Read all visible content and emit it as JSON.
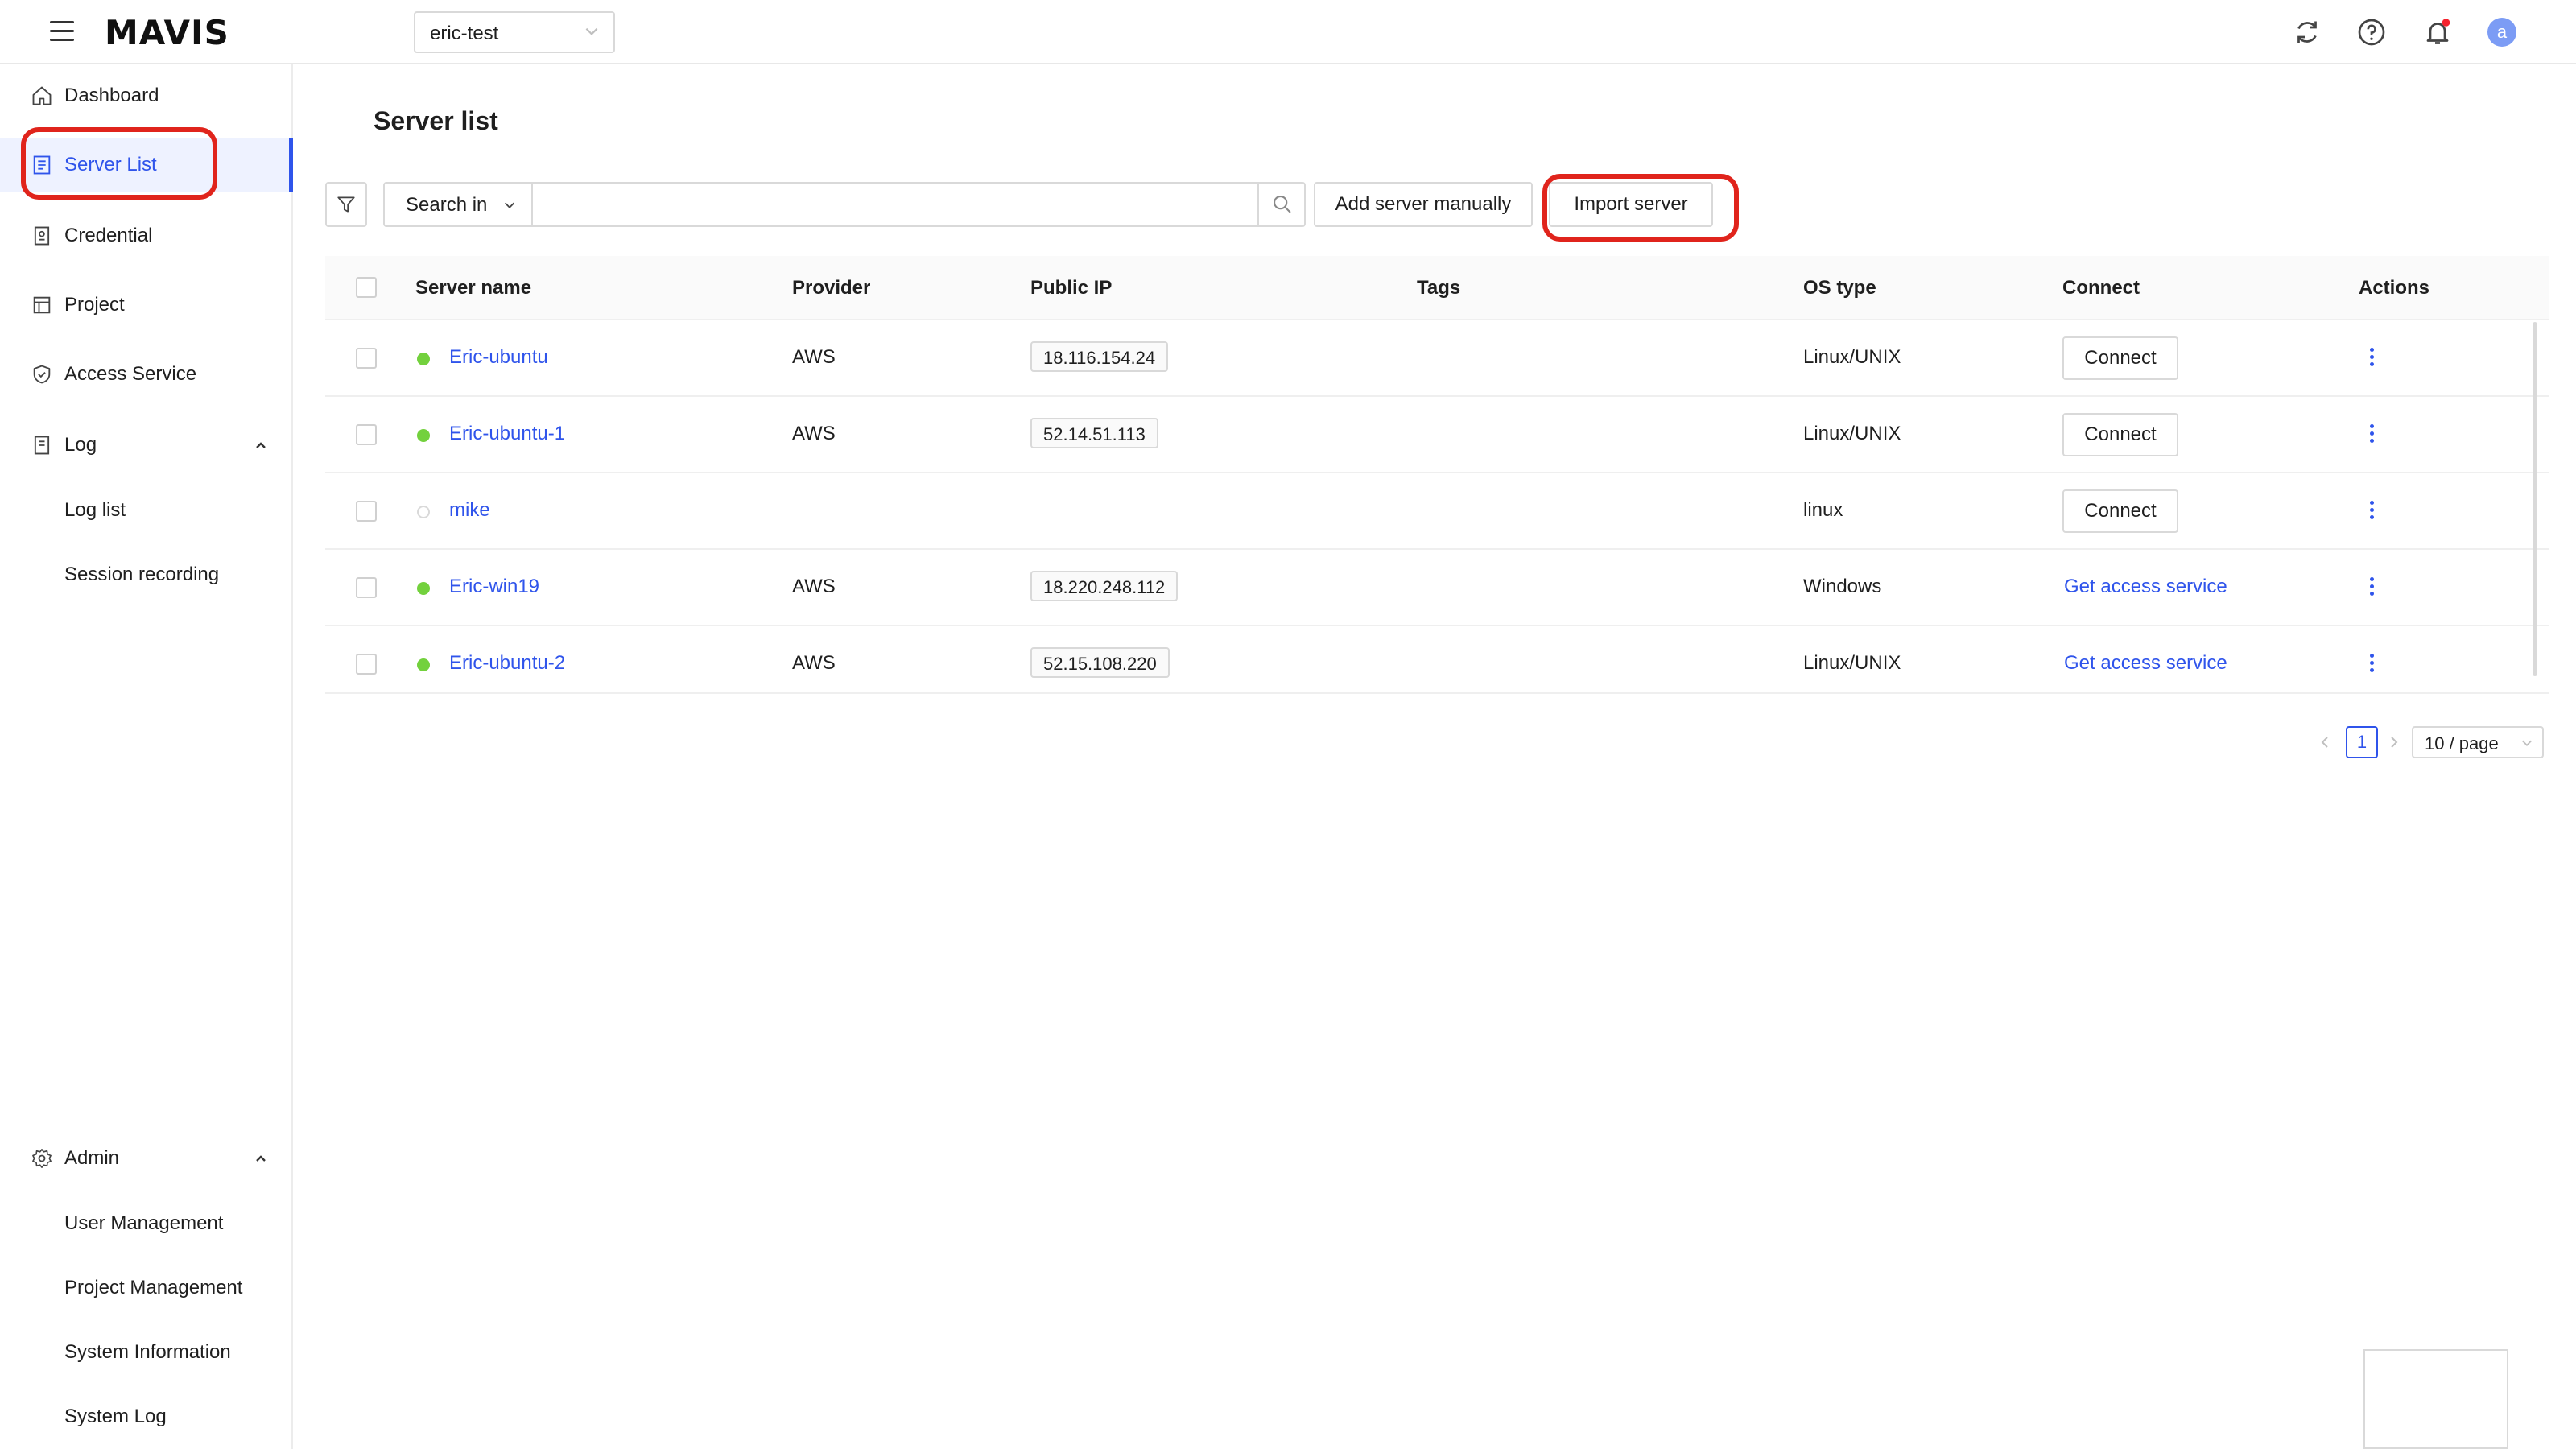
{
  "app": {
    "logo": "MAVIS",
    "project_selector": "eric-test"
  },
  "sidebar": {
    "items": [
      {
        "label": "Dashboard",
        "icon": "home-icon"
      },
      {
        "label": "Server List",
        "icon": "server-list-icon",
        "active": true
      },
      {
        "label": "Credential",
        "icon": "credential-icon"
      },
      {
        "label": "Project",
        "icon": "project-icon"
      },
      {
        "label": "Access Service",
        "icon": "shield-icon"
      },
      {
        "label": "Log",
        "icon": "log-icon",
        "expanded": true
      }
    ],
    "log_children": [
      "Log list",
      "Session recording"
    ],
    "admin": {
      "label": "Admin",
      "icon": "gear-icon",
      "expanded": true
    },
    "admin_children": [
      "User Management",
      "Project Management",
      "System Information",
      "System Log"
    ]
  },
  "main": {
    "title": "Server list",
    "search_in_label": "Search in",
    "search_placeholder": "",
    "add_server_label": "Add server manually",
    "import_server_label": "Import server"
  },
  "table": {
    "columns": [
      "Server name",
      "Provider",
      "Public IP",
      "Tags",
      "OS type",
      "Connect",
      "Actions"
    ],
    "rows": [
      {
        "name": "Eric-ubuntu",
        "status": "online",
        "provider": "AWS",
        "ip": "18.116.154.24",
        "tags": "",
        "os": "Linux/UNIX",
        "connect": "Connect",
        "connect_type": "button"
      },
      {
        "name": "Eric-ubuntu-1",
        "status": "online",
        "provider": "AWS",
        "ip": "52.14.51.113",
        "tags": "",
        "os": "Linux/UNIX",
        "connect": "Connect",
        "connect_type": "button"
      },
      {
        "name": "mike",
        "status": "unknown",
        "provider": "",
        "ip": "",
        "tags": "",
        "os": "linux",
        "connect": "Connect",
        "connect_type": "button"
      },
      {
        "name": "Eric-win19",
        "status": "online",
        "provider": "AWS",
        "ip": "18.220.248.112",
        "tags": "",
        "os": "Windows",
        "connect": "Get access service",
        "connect_type": "link"
      },
      {
        "name": "Eric-ubuntu-2",
        "status": "online",
        "provider": "AWS",
        "ip": "52.15.108.220",
        "tags": "",
        "os": "Linux/UNIX",
        "connect": "Get access service",
        "connect_type": "link"
      }
    ]
  },
  "pagination": {
    "current_page": "1",
    "page_size": "10 / page"
  },
  "colors": {
    "accent": "#2f54eb",
    "status_online": "#73d13d",
    "status_unknown": "#d9d9d9",
    "highlight": "#e0241c",
    "notification_dot": "#f5222d",
    "avatar": "#7c9cf5"
  },
  "topbar_icons": [
    "refresh-icon",
    "help-icon",
    "bell-icon",
    "avatar"
  ],
  "avatar_letter": "a"
}
